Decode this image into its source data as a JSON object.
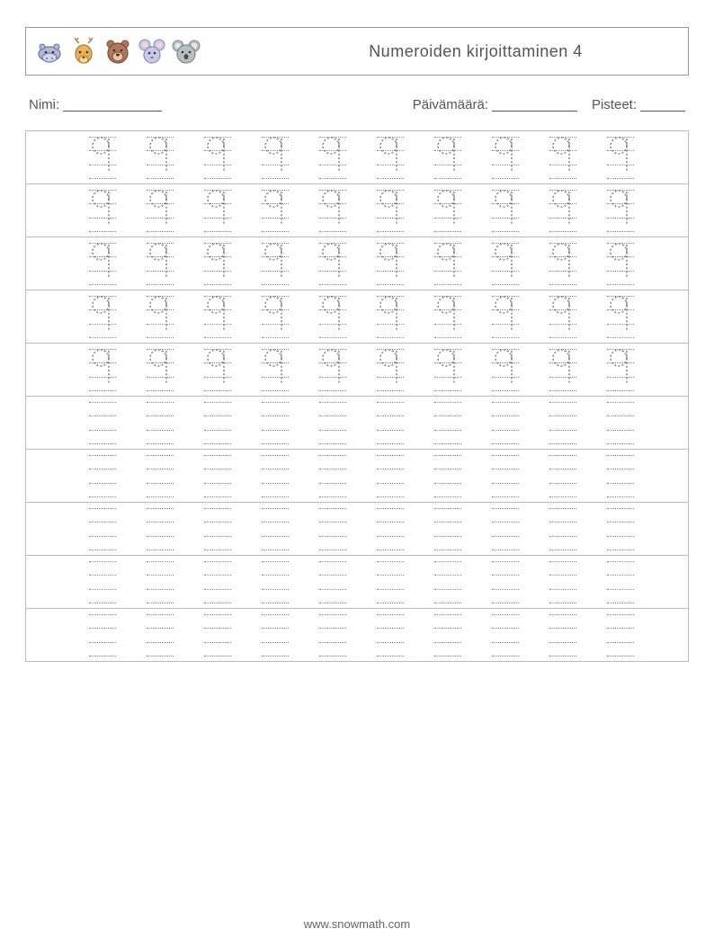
{
  "header": {
    "title": "Numeroiden kirjoittaminen 4",
    "animals": [
      "hippo-icon",
      "deer-icon",
      "bear-icon",
      "mouse-icon",
      "koala-icon"
    ]
  },
  "meta": {
    "name_label": "Nimi:",
    "date_label": "Päivämäärä:",
    "score_label": "Pisteet:"
  },
  "practice": {
    "glyph": "q",
    "rows_with_glyph": 5,
    "rows_blank": 5,
    "cells_per_row": 10
  },
  "footer": {
    "url": "www.snowmath.com"
  }
}
